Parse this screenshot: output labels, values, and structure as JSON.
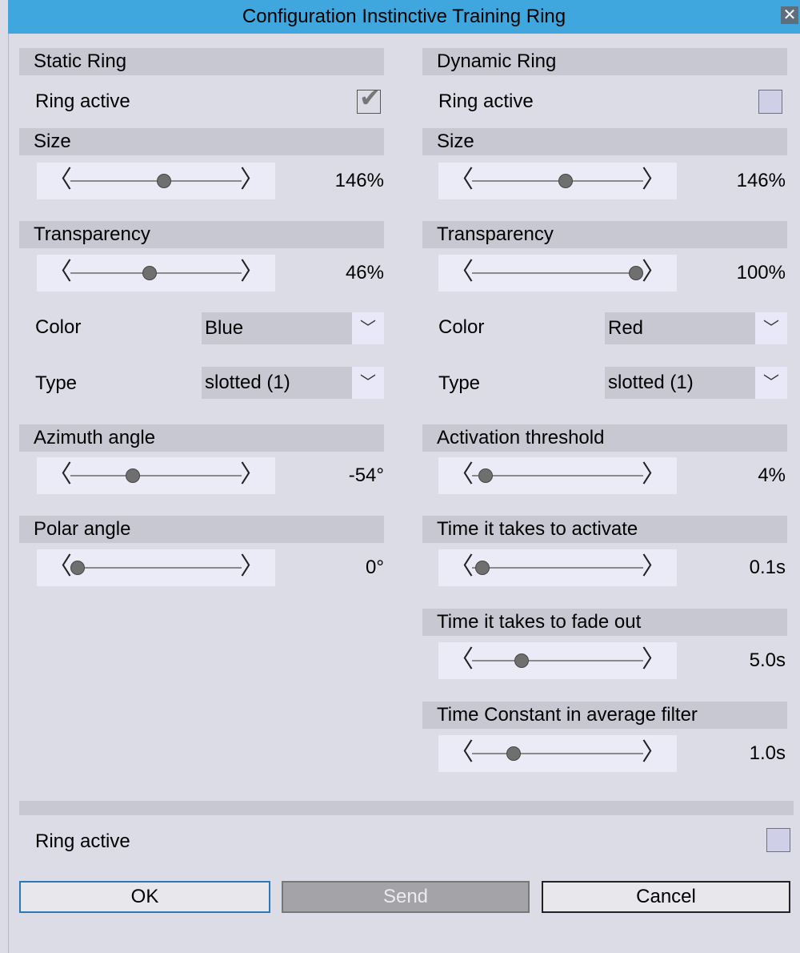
{
  "window": {
    "title": "Configuration Instinctive Training Ring",
    "close_glyph": "✕"
  },
  "static_ring": {
    "header": "Static Ring",
    "ring_active_label": "Ring active",
    "ring_active": true,
    "size": {
      "label": "Size",
      "value": "146%",
      "level": 0.55
    },
    "transparency": {
      "label": "Transparency",
      "value": "46%",
      "level": 0.46
    },
    "color": {
      "label": "Color",
      "value": "Blue"
    },
    "type": {
      "label": "Type",
      "value": "slotted (1)"
    },
    "azimuth": {
      "label": "Azimuth angle",
      "value": "-54°",
      "level": 0.35
    },
    "polar": {
      "label": "Polar angle",
      "value": "0°",
      "level": 0.0
    }
  },
  "dynamic_ring": {
    "header": "Dynamic Ring",
    "ring_active_label": "Ring active",
    "ring_active": false,
    "size": {
      "label": "Size",
      "value": "146%",
      "level": 0.55
    },
    "transparency": {
      "label": "Transparency",
      "value": "100%",
      "level": 1.0
    },
    "color": {
      "label": "Color",
      "value": "Red"
    },
    "type": {
      "label": "Type",
      "value": "slotted (1)"
    },
    "activation_threshold": {
      "label": "Activation threshold",
      "value": "4%",
      "level": 0.04
    },
    "activate_time": {
      "label": "Time it takes to activate",
      "value": "0.1s",
      "level": 0.02
    },
    "fade_time": {
      "label": "Time it takes to fade out",
      "value": "5.0s",
      "level": 0.27
    },
    "time_constant": {
      "label": "Time Constant in average filter",
      "value": "1.0s",
      "level": 0.22
    }
  },
  "footer": {
    "ring_active_label": "Ring active",
    "ring_active": false,
    "ok_label": "OK",
    "send_label": "Send",
    "cancel_label": "Cancel"
  },
  "icons": {
    "left_arrow": "〈",
    "right_arrow": "〉",
    "caret": "﹀",
    "check": "✔"
  },
  "colors": {
    "title_bar": "#3fa7dd",
    "panel": "#dcdce6",
    "section": "#c8c8d3",
    "checkbox": "#cfcfe8"
  }
}
